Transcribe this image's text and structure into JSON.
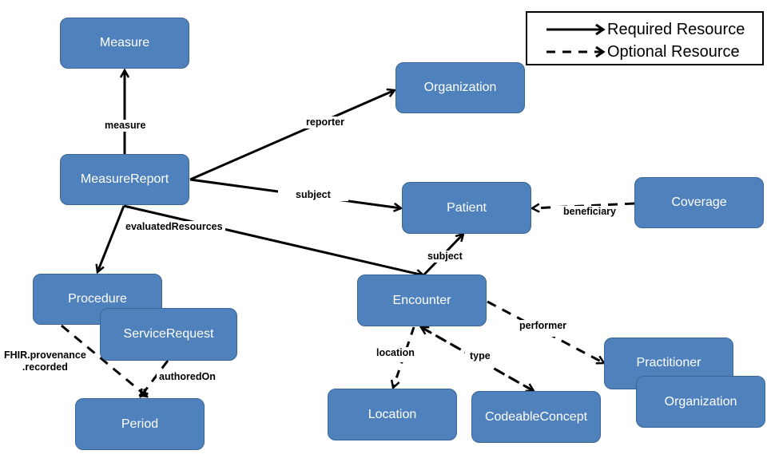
{
  "legend": {
    "required": "Required Resource",
    "optional": "Optional Resource"
  },
  "nodes": {
    "measure": "Measure",
    "measure_report": "MeasureReport",
    "organization_top": "Organization",
    "patient": "Patient",
    "coverage": "Coverage",
    "procedure": "Procedure",
    "service_request": "ServiceRequest",
    "period": "Period",
    "encounter": "Encounter",
    "location": "Location",
    "codeable_concept": "CodeableConcept",
    "practitioner": "Practitioner",
    "organization_bottom": "Organization"
  },
  "edges": {
    "measure": "measure",
    "reporter": "reporter",
    "subject_patient": "subject",
    "evaluated_resources": "evaluatedResources",
    "beneficiary": "beneficiary",
    "subject_encounter": "subject",
    "provenance_line1": "FHIR.provenance",
    "provenance_line2": ".recorded",
    "authored_on": "authoredOn",
    "location": "location",
    "type": "type",
    "performer": "performer"
  },
  "colors": {
    "node_fill": "#4f81bd",
    "node_border": "#3a6595",
    "edge": "#000000"
  }
}
